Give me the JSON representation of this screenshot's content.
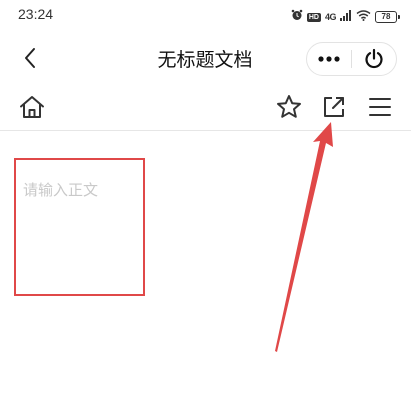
{
  "status_bar": {
    "time": "23:24",
    "hd_badge": "HD",
    "network": "4G",
    "battery_level": "78"
  },
  "nav": {
    "title": "无标题文档"
  },
  "editor": {
    "placeholder": "请输入正文"
  },
  "icons": {
    "back": "chevron-left-icon",
    "more": "more-dots-icon",
    "close": "power-icon",
    "home": "home-icon",
    "favorite": "star-icon",
    "share": "external-link-icon",
    "menu": "hamburger-menu-icon"
  },
  "colors": {
    "annotation_red": "#e04848",
    "placeholder_gray": "#c9c9c9",
    "icon_dark": "#333333"
  }
}
